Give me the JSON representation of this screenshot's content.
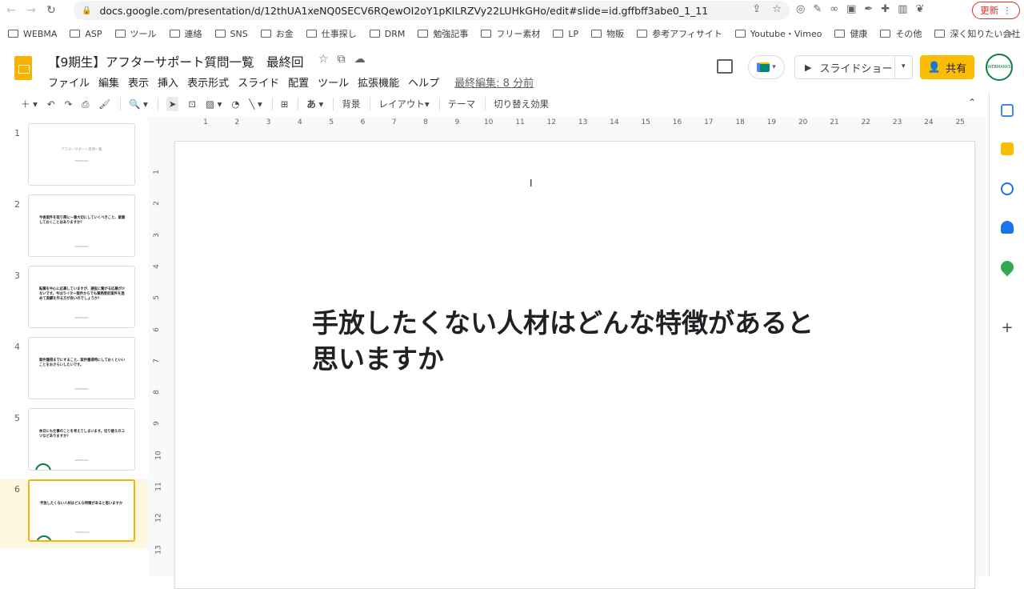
{
  "browser": {
    "url": "docs.google.com/presentation/d/12thUA1xeNQ0SECV6RQewOI2oY1pKILRZVy22LUHkGHo/edit#slide=id.gffbff3abe0_1_11",
    "update_label": "更新",
    "bookmarks": [
      "WEBMA",
      "ASP",
      "ツール",
      "連絡",
      "SNS",
      "お金",
      "仕事探し",
      "DRM",
      "勉強記事",
      "フリー素材",
      "LP",
      "物販",
      "参考アフィサイト",
      "Youtube・Vimeo",
      "健康",
      "その他",
      "深く知りたい会社"
    ],
    "bookmarks_more": "»"
  },
  "doc": {
    "title": "【9期生】アフターサポート質問一覧　最終回",
    "menu": [
      "ファイル",
      "編集",
      "表示",
      "挿入",
      "表示形式",
      "スライド",
      "配置",
      "ツール",
      "拡張機能",
      "ヘルプ"
    ],
    "last_edit": "最終編集: 8 分前",
    "slideshow_label": "スライドショー",
    "share_label": "共有",
    "avatar_text": "WEBMARKS"
  },
  "toolbar": {
    "background": "背景",
    "layout": "レイアウト",
    "theme": "テーマ",
    "transition": "切り替え効果",
    "input_mode": "あ"
  },
  "ruler": {
    "h": [
      "1",
      "2",
      "3",
      "4",
      "5",
      "6",
      "7",
      "8",
      "9",
      "10",
      "11",
      "12",
      "13",
      "14",
      "15",
      "16",
      "17",
      "18",
      "19",
      "20",
      "21",
      "22",
      "23",
      "24",
      "25"
    ],
    "v": [
      "1",
      "2",
      "3",
      "4",
      "5",
      "6",
      "7",
      "8",
      "9",
      "10",
      "11",
      "12",
      "13"
    ]
  },
  "slides": [
    {
      "num": "1",
      "text": "アフターサポート質問一覧",
      "sub": "WEBMARKS",
      "style": "title"
    },
    {
      "num": "2",
      "text": "今後案件を取り際に一番大切にしていくべきこと、意識しておくことはありますか？",
      "sub": "WEBMARKS",
      "style": "q"
    },
    {
      "num": "3",
      "text": "転職を中心に応募していますが、選抜に繋がる応募が少ないです。今はライター案件からでも業務委託案件を進めて実績を作る方が良いのでしょうか？",
      "sub": "WEBMARKS",
      "style": "q"
    },
    {
      "num": "4",
      "text": "案件獲得までにすること、案件獲得時にしておくといいことをおさらいしたいです。",
      "sub": "WEBMARKS",
      "style": "q"
    },
    {
      "num": "5",
      "text": "休日にも仕事のことを考えてしまいます。切り替えのコツなどありますか？",
      "sub": "WEBMARKS",
      "style": "q"
    },
    {
      "num": "6",
      "text": "手放したくない人材はどんな特徴があると思いますか",
      "sub": "WEBMARKS",
      "style": "q"
    }
  ],
  "current_slide": {
    "line1": "手放したくない人材はどんな特徴があると",
    "line2": "思いますか"
  },
  "colors": {
    "accent": "#f4b400",
    "share": "#fbbc04",
    "update": "#d93025",
    "avatar_ring": "#0b8043"
  }
}
